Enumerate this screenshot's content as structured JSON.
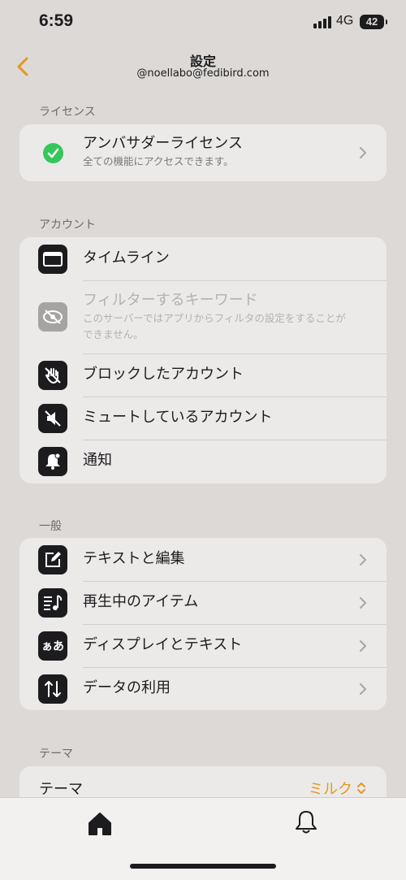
{
  "status_bar": {
    "time": "6:59",
    "network": "4G",
    "battery": "42"
  },
  "nav": {
    "title": "設定",
    "subtitle": "@noellabo@fedibird.com"
  },
  "sections": {
    "license": {
      "header": "ライセンス",
      "ambassador": {
        "title": "アンバサダーライセンス",
        "subtitle": "全ての機能にアクセスできます。"
      }
    },
    "account": {
      "header": "アカウント",
      "items": [
        {
          "title": "タイムライン"
        },
        {
          "title": "フィルターするキーワード",
          "subtitle": "このサーバーではアプリからフィルタの設定をすることができません。"
        },
        {
          "title": "ブロックしたアカウント"
        },
        {
          "title": "ミュートしているアカウント"
        },
        {
          "title": "通知"
        }
      ]
    },
    "general": {
      "header": "一般",
      "items": [
        {
          "title": "テキストと編集"
        },
        {
          "title": "再生中のアイテム"
        },
        {
          "title": "ディスプレイとテキスト",
          "icon_text": "ぁあ"
        },
        {
          "title": "データの利用"
        }
      ]
    },
    "theme": {
      "header": "テーマ",
      "row": {
        "label": "テーマ",
        "value": "ミルク"
      }
    }
  },
  "colors": {
    "accent": "#e8961e",
    "check_green": "#34c759",
    "background": "#dcd9d6",
    "card": "#ebeae9"
  },
  "icons": {
    "back": "chevron-left-icon",
    "timeline": "timeline-icon",
    "filter": "eye-slash-icon",
    "blocked": "hand-icon",
    "muted": "speaker-mute-icon",
    "notifications": "bell-icon",
    "text_editing": "compose-icon",
    "now_playing": "music-list-icon",
    "display": "kana-icon",
    "data": "arrows-up-down-icon",
    "tab_home": "home-icon",
    "tab_notifications": "bell-icon"
  }
}
